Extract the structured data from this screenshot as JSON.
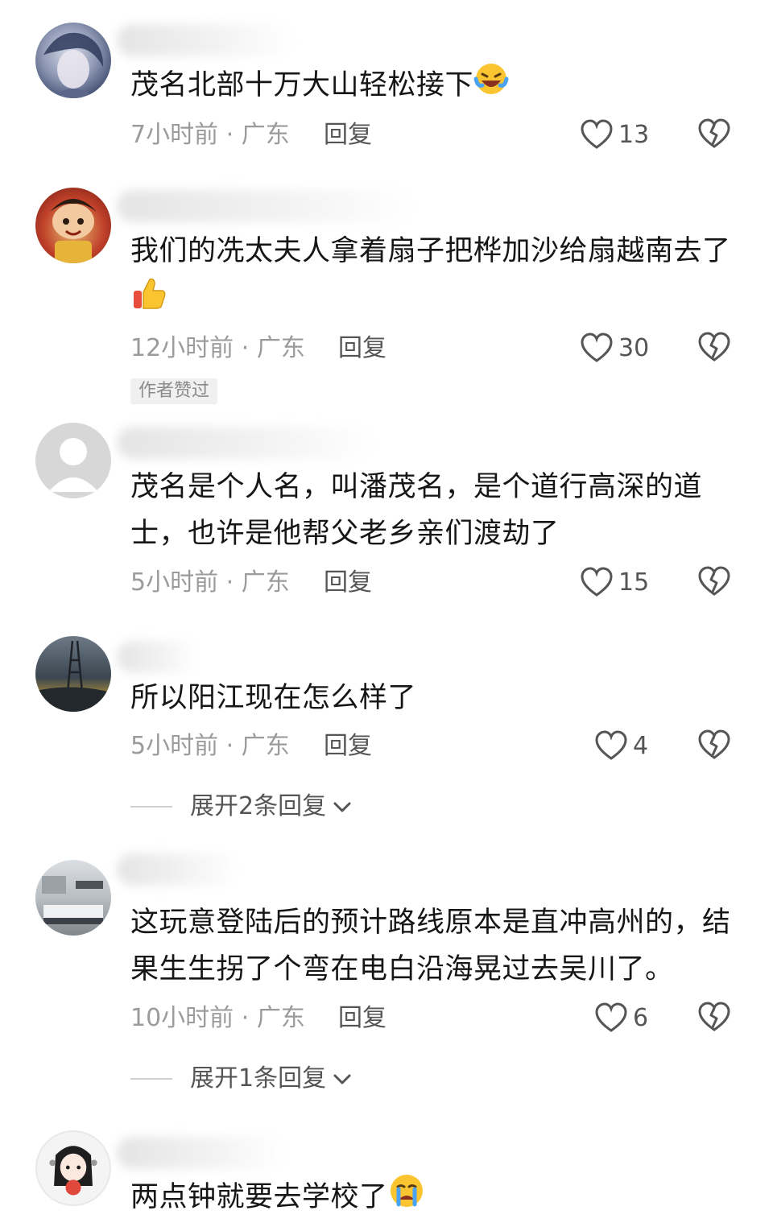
{
  "comments": [
    {
      "text": "茂名北部十万大山轻松接下",
      "emoji": "laughing-tears-emoji",
      "time": "7小时前",
      "region": "广东",
      "reply_label": "回复",
      "likes": "13"
    },
    {
      "text": "我们的冼太夫人拿着扇子把桦加沙给扇越南去了",
      "emoji": "thumbs-up-emoji",
      "time": "12小时前",
      "region": "广东",
      "reply_label": "回复",
      "likes": "30",
      "author_tag": "作者赞过"
    },
    {
      "text": "茂名是个人名，叫潘茂名，是个道行高深的道士，也许是他帮父老乡亲们渡劫了",
      "time": "5小时前",
      "region": "广东",
      "reply_label": "回复",
      "likes": "15"
    },
    {
      "text": "所以阳江现在怎么样了",
      "time": "5小时前",
      "region": "广东",
      "reply_label": "回复",
      "likes": "4",
      "expand_label": "展开2条回复"
    },
    {
      "text": "这玩意登陆后的预计路线原本是直冲高州的，结果生生拐了个弯在电白沿海晃过去吴川了。",
      "time": "10小时前",
      "region": "广东",
      "reply_label": "回复",
      "likes": "6",
      "expand_label": "展开1条回复"
    },
    {
      "text": "两点钟就要去学校了",
      "emoji": "crying-emoji"
    }
  ],
  "separator": "·",
  "colors": {
    "text": "#161616",
    "meta": "#9b9b9b",
    "tag_bg": "#f0f0f0"
  }
}
